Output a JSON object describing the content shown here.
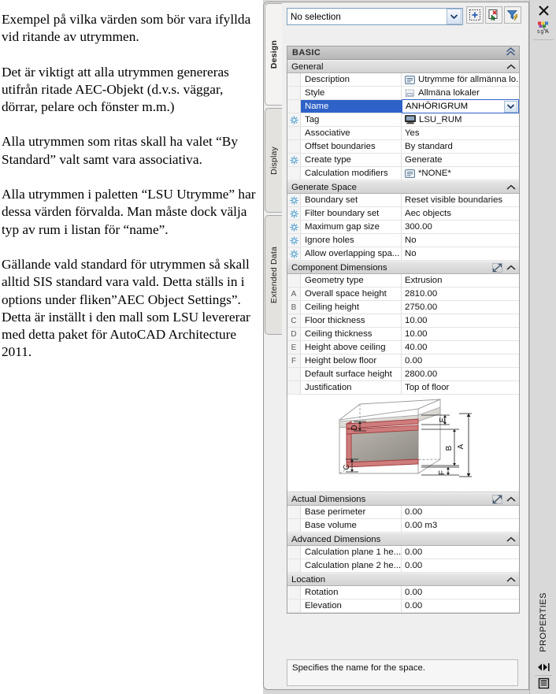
{
  "document": {
    "paragraphs": [
      "Exempel på vilka värden som bör vara ifyllda vid ritande av utrymmen.",
      "Det är viktigt att alla utrymmen genereras utifrån ritade AEC-Objekt (d.v.s. väggar, dörrar, pelare och fönster m.m.)",
      "Alla utrymmen som ritas skall ha valet “By Standard” valt samt vara associativa.",
      "Alla utrymmen i paletten “LSU Utrymme” har dessa värden förvalda. Man måste dock välja typ av rum i listan för “name”.",
      "Gällande vald standard för utrymmen så skall alltid SIS standard vara vald. Detta ställs in i options under fliken”AEC Object Settings”. Detta är inställt i den mall som LSU levererar med detta paket för AutoCAD Architecture 2011."
    ]
  },
  "palette": {
    "title": "PROPERTIES",
    "tabs": [
      {
        "label": "Design",
        "active": true
      },
      {
        "label": "Display",
        "active": false
      },
      {
        "label": "Extended Data",
        "active": false
      }
    ],
    "selector": {
      "value": "No selection",
      "placeholder": "No selection"
    },
    "toolbar": [
      {
        "name": "select-objects-button",
        "tooltip": "Select objects"
      },
      {
        "name": "quick-select-button",
        "tooltip": "Quick Select"
      },
      {
        "name": "quick-properties-filter-button",
        "tooltip": "Quick properties filter"
      }
    ],
    "basic_bar": {
      "label": "BASIC",
      "chevron": "chevron-up-icon"
    },
    "sections": [
      {
        "id": "general",
        "label": "General",
        "has_expand_icon": false,
        "rows": [
          {
            "gutter": "",
            "dim": "",
            "name": "Description",
            "value": "Utrymme för allmänna lo...",
            "icon": "note-icon",
            "selected": false
          },
          {
            "gutter": "",
            "dim": "",
            "name": "Style",
            "value": "Allmäna lokaler",
            "icon": "style-icon",
            "selected": false
          },
          {
            "gutter": "",
            "dim": "",
            "name": "Name",
            "value": "ANHÖRIGRUM",
            "icon": "",
            "selected": true,
            "dropdown": true
          },
          {
            "gutter": "asterisk-icon",
            "dim": "",
            "name": "Tag",
            "value": "LSU_RUM",
            "icon": "monitor-icon",
            "selected": false
          },
          {
            "gutter": "",
            "dim": "",
            "name": "Associative",
            "value": "Yes",
            "icon": "",
            "selected": false
          },
          {
            "gutter": "",
            "dim": "",
            "name": "Offset boundaries",
            "value": "By standard",
            "icon": "",
            "selected": false
          },
          {
            "gutter": "asterisk-icon",
            "dim": "",
            "name": "Create type",
            "value": "Generate",
            "icon": "",
            "selected": false
          },
          {
            "gutter": "",
            "dim": "",
            "name": "Calculation modifiers",
            "value": "*NONE*",
            "icon": "note-icon",
            "selected": false
          }
        ]
      },
      {
        "id": "generate-space",
        "label": "Generate Space",
        "has_expand_icon": false,
        "rows": [
          {
            "gutter": "asterisk-icon",
            "dim": "",
            "name": "Boundary set",
            "value": "Reset visible boundaries",
            "icon": "",
            "selected": false
          },
          {
            "gutter": "asterisk-icon",
            "dim": "",
            "name": "Filter boundary set",
            "value": "Aec objects",
            "icon": "",
            "selected": false
          },
          {
            "gutter": "asterisk-icon",
            "dim": "",
            "name": "Maximum gap size",
            "value": "300.00",
            "icon": "",
            "selected": false
          },
          {
            "gutter": "asterisk-icon",
            "dim": "",
            "name": "Ignore holes",
            "value": "No",
            "icon": "",
            "selected": false
          },
          {
            "gutter": "asterisk-icon",
            "dim": "",
            "name": "Allow overlapping spa...",
            "value": "No",
            "icon": "",
            "selected": false
          }
        ]
      },
      {
        "id": "component-dimensions",
        "label": "Component Dimensions",
        "has_expand_icon": true,
        "rows": [
          {
            "gutter": "",
            "dim": "",
            "name": "Geometry type",
            "value": "Extrusion",
            "icon": "",
            "selected": false
          },
          {
            "gutter": "",
            "dim": "A",
            "name": "Overall space height",
            "value": "2810.00",
            "icon": "",
            "selected": false
          },
          {
            "gutter": "",
            "dim": "B",
            "name": "Ceiling height",
            "value": "2750.00",
            "icon": "",
            "selected": false
          },
          {
            "gutter": "",
            "dim": "C",
            "name": "Floor thickness",
            "value": "10.00",
            "icon": "",
            "selected": false
          },
          {
            "gutter": "",
            "dim": "D",
            "name": "Ceiling thickness",
            "value": "10.00",
            "icon": "",
            "selected": false
          },
          {
            "gutter": "",
            "dim": "E",
            "name": "Height above ceiling",
            "value": "40.00",
            "icon": "",
            "selected": false
          },
          {
            "gutter": "",
            "dim": "F",
            "name": "Height below floor",
            "value": "0.00",
            "icon": "",
            "selected": false
          },
          {
            "gutter": "",
            "dim": "",
            "name": "Default surface height",
            "value": "2800.00",
            "icon": "",
            "selected": false
          },
          {
            "gutter": "",
            "dim": "",
            "name": "Justification",
            "value": "Top of floor",
            "icon": "",
            "selected": false
          }
        ],
        "preview": {
          "name": "space-component-dimensions-diagram",
          "labels": [
            "A",
            "B",
            "C",
            "D",
            "E",
            "F"
          ]
        }
      },
      {
        "id": "actual-dimensions",
        "label": "Actual Dimensions",
        "has_expand_icon": true,
        "rows": [
          {
            "gutter": "",
            "dim": "",
            "name": "Base perimeter",
            "value": "0.00",
            "icon": "",
            "selected": false
          },
          {
            "gutter": "",
            "dim": "",
            "name": "Base volume",
            "value": "0.00 m3",
            "icon": "",
            "selected": false
          }
        ]
      },
      {
        "id": "advanced-dimensions",
        "label": "Advanced Dimensions",
        "has_expand_icon": false,
        "rows": [
          {
            "gutter": "",
            "dim": "",
            "name": "Calculation plane  1 he...",
            "value": "0.00",
            "icon": "",
            "selected": false
          },
          {
            "gutter": "",
            "dim": "",
            "name": "Calculation plane 2 he...",
            "value": "0.00",
            "icon": "",
            "selected": false
          }
        ]
      },
      {
        "id": "location",
        "label": "Location",
        "has_expand_icon": false,
        "rows": [
          {
            "gutter": "",
            "dim": "",
            "name": "Rotation",
            "value": "0.00",
            "icon": "",
            "selected": false
          },
          {
            "gutter": "",
            "dim": "",
            "name": "Elevation",
            "value": "0.00",
            "icon": "",
            "selected": false
          }
        ]
      }
    ],
    "description": "Specifies the name for the space.",
    "close_icon": "close-icon",
    "color_icon": "change-color-icon",
    "autohide_icon": "auto-hide-icon",
    "menu_icon": "palette-menu-icon"
  },
  "colors": {
    "selection_blue": "#2e62c8",
    "accent_red": "#c0504d",
    "panel_gray": "#d9d9d9",
    "header_gray": "#d2d2d2"
  }
}
